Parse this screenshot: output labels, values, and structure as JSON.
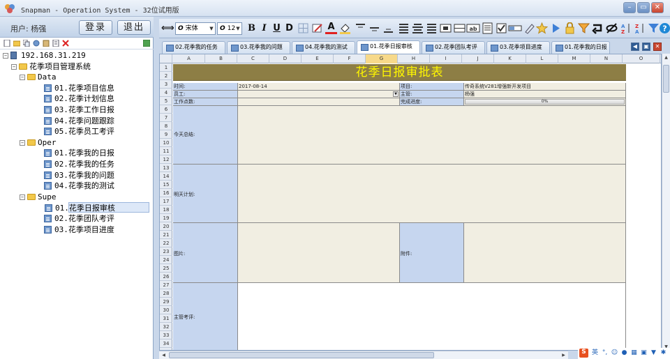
{
  "window": {
    "title": "Snapman - Operation System - 32位试用版",
    "min": "–",
    "max": "▭",
    "close": "✕"
  },
  "user": {
    "label": "用户: 杨强",
    "login": "登录",
    "logout": "退出"
  },
  "tree": {
    "server": "192.168.31.219",
    "system": "花季项目管理系统",
    "groups": [
      {
        "name": "Data",
        "items": [
          "01.花季项目信息",
          "02.花季计划信息",
          "03.花季工作日报",
          "04.花季问题跟踪",
          "05.花季员工考评"
        ]
      },
      {
        "name": "Oper",
        "items": [
          "01.花季我的日报",
          "02.花季我的任务",
          "03.花季我的问题",
          "04.花季我的测试"
        ]
      },
      {
        "name": "Supe",
        "items": [
          "01.花季日报审核",
          "02.花季团队考评",
          "03.花季项目进度"
        ]
      }
    ],
    "selected": "01.花季日报审核"
  },
  "toolbar": {
    "font_name": "宋体",
    "font_size": "12",
    "bold": "B",
    "italic": "I",
    "underline": "U",
    "strike": "D",
    "font_color": "A"
  },
  "tabs": [
    "02.花季我的任务",
    "03.花季我的问题",
    "04.花季我的测试",
    "01.花季日报审核",
    "02.花季团队考评",
    "03.花季项目进度",
    "01.花季我的日报"
  ],
  "active_tab": "01.花季日报审核",
  "columns": [
    "A",
    "B",
    "C",
    "D",
    "E",
    "F",
    "G",
    "H",
    "I",
    "J",
    "K",
    "L",
    "M",
    "N",
    "O"
  ],
  "selected_column": "G",
  "rows": [
    "1",
    "2",
    "3",
    "4",
    "5",
    "6",
    "7",
    "8",
    "9",
    "10",
    "11",
    "12",
    "13",
    "14",
    "15",
    "16",
    "17",
    "18",
    "19",
    "20",
    "21",
    "22",
    "23",
    "24",
    "25",
    "26",
    "27",
    "28",
    "29",
    "30",
    "31",
    "32",
    "33",
    "34"
  ],
  "sheet": {
    "title": "花季日报审批表",
    "time_label": "时间:",
    "time_value": "2017-08-14",
    "project_label": "项目:",
    "project_value": "传奇系统V281增强新开发项目",
    "staff_label": "员工:",
    "manager_label": "主管:",
    "manager_value": "杨强",
    "work_label": "工作点数:",
    "progress_label": "完成进度:",
    "progress_value": "0%",
    "progress_fraction": 0,
    "summary_label": "今天总结:",
    "plan_label": "明天计划:",
    "image_label": "图片:",
    "attach_label": "附件:",
    "review_label": "主管考评:"
  },
  "tray": {
    "lang": "英",
    "brand_color": "#e8501f"
  }
}
